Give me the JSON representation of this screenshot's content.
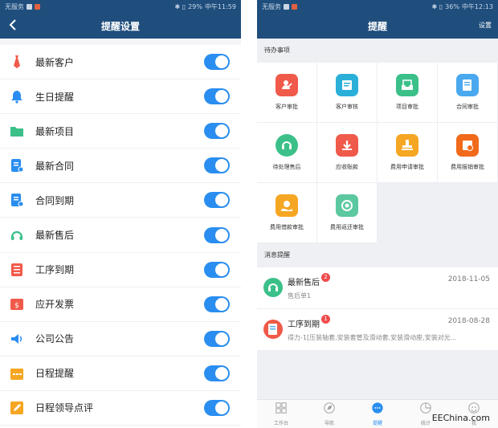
{
  "left": {
    "status": {
      "carrier": "无服务",
      "battery": "29%",
      "time": "中午11:59"
    },
    "header": {
      "title": "提醒设置",
      "back_icon": "chevron-left-icon"
    },
    "settings": [
      {
        "label": "最新客户",
        "icon": "tie-icon",
        "color": "#f05a4a",
        "enabled": true
      },
      {
        "label": "生日提醒",
        "icon": "bell-icon",
        "color": "#2a8ef0",
        "enabled": true
      },
      {
        "label": "最新项目",
        "icon": "folder-icon",
        "color": "#3cc08a",
        "enabled": true
      },
      {
        "label": "最新合同",
        "icon": "contract-icon",
        "color": "#2a8ef0",
        "enabled": true
      },
      {
        "label": "合同到期",
        "icon": "contract-expire-icon",
        "color": "#2a8ef0",
        "enabled": true
      },
      {
        "label": "最新售后",
        "icon": "headset-icon",
        "color": "#3cc08a",
        "enabled": true
      },
      {
        "label": "工序到期",
        "icon": "checklist-icon",
        "color": "#f05a4a",
        "enabled": true
      },
      {
        "label": "应开发票",
        "icon": "invoice-icon",
        "color": "#f05a4a",
        "enabled": true
      },
      {
        "label": "公司公告",
        "icon": "speaker-icon",
        "color": "#2a8ef0",
        "enabled": true
      },
      {
        "label": "日程提醒",
        "icon": "calendar-icon",
        "color": "#f5a623",
        "enabled": true
      },
      {
        "label": "日程领导点评",
        "icon": "pen-icon",
        "color": "#f5a623",
        "enabled": true
      }
    ]
  },
  "right": {
    "status": {
      "carrier": "无服务",
      "battery": "36%",
      "time": "中午12:13"
    },
    "header": {
      "title": "提醒",
      "settings_label": "设置"
    },
    "todo_section": "待办事项",
    "todo_items": [
      {
        "label": "客户审批",
        "icon": "customer-approve-icon",
        "color": "#f05a4a",
        "round": false
      },
      {
        "label": "客户审核",
        "icon": "customer-review-icon",
        "color": "#2ab0d8",
        "round": false
      },
      {
        "label": "项目审批",
        "icon": "project-inbox-icon",
        "color": "#3cc08a",
        "round": false
      },
      {
        "label": "合同审批",
        "icon": "contract-approve-icon",
        "color": "#4aa8ee",
        "round": false
      },
      {
        "label": "待处理售后",
        "icon": "headset-icon",
        "color": "#3cc08a",
        "round": true
      },
      {
        "label": "应收账款",
        "icon": "receivable-icon",
        "color": "#f05a4a",
        "round": false
      },
      {
        "label": "费用申请审批",
        "icon": "stamp-icon",
        "color": "#f5a623",
        "round": false
      },
      {
        "label": "费用报销审批",
        "icon": "reimburse-icon",
        "color": "#f06a1a",
        "round": false
      },
      {
        "label": "费用借款审批",
        "icon": "loan-icon",
        "color": "#f5a623",
        "round": false
      },
      {
        "label": "费用返还审批",
        "icon": "refund-icon",
        "color": "#5cc8a0",
        "round": false
      }
    ],
    "msg_section": "消息提醒",
    "messages": [
      {
        "title": "最新售后",
        "badge": "2",
        "date": "2018-11-05",
        "sub": "售后单1",
        "icon": "headset-icon",
        "color": "#3cc08a"
      },
      {
        "title": "工序到期",
        "badge": "1",
        "date": "2018-08-28",
        "sub": "得力-1[压装轴套,安装套管及滑动套,安装滑动座,安装对光...",
        "icon": "checklist-icon",
        "color": "#f05a4a"
      }
    ],
    "tabs": [
      {
        "label": "工作台",
        "icon": "workbench-icon",
        "active": false
      },
      {
        "label": "导航",
        "icon": "navigate-icon",
        "active": false
      },
      {
        "label": "提醒",
        "icon": "chat-bubble-icon",
        "active": true
      },
      {
        "label": "统计",
        "icon": "stats-icon",
        "active": false
      },
      {
        "label": "我",
        "icon": "profile-icon",
        "active": false
      }
    ],
    "watermark": "EEChina.com"
  }
}
